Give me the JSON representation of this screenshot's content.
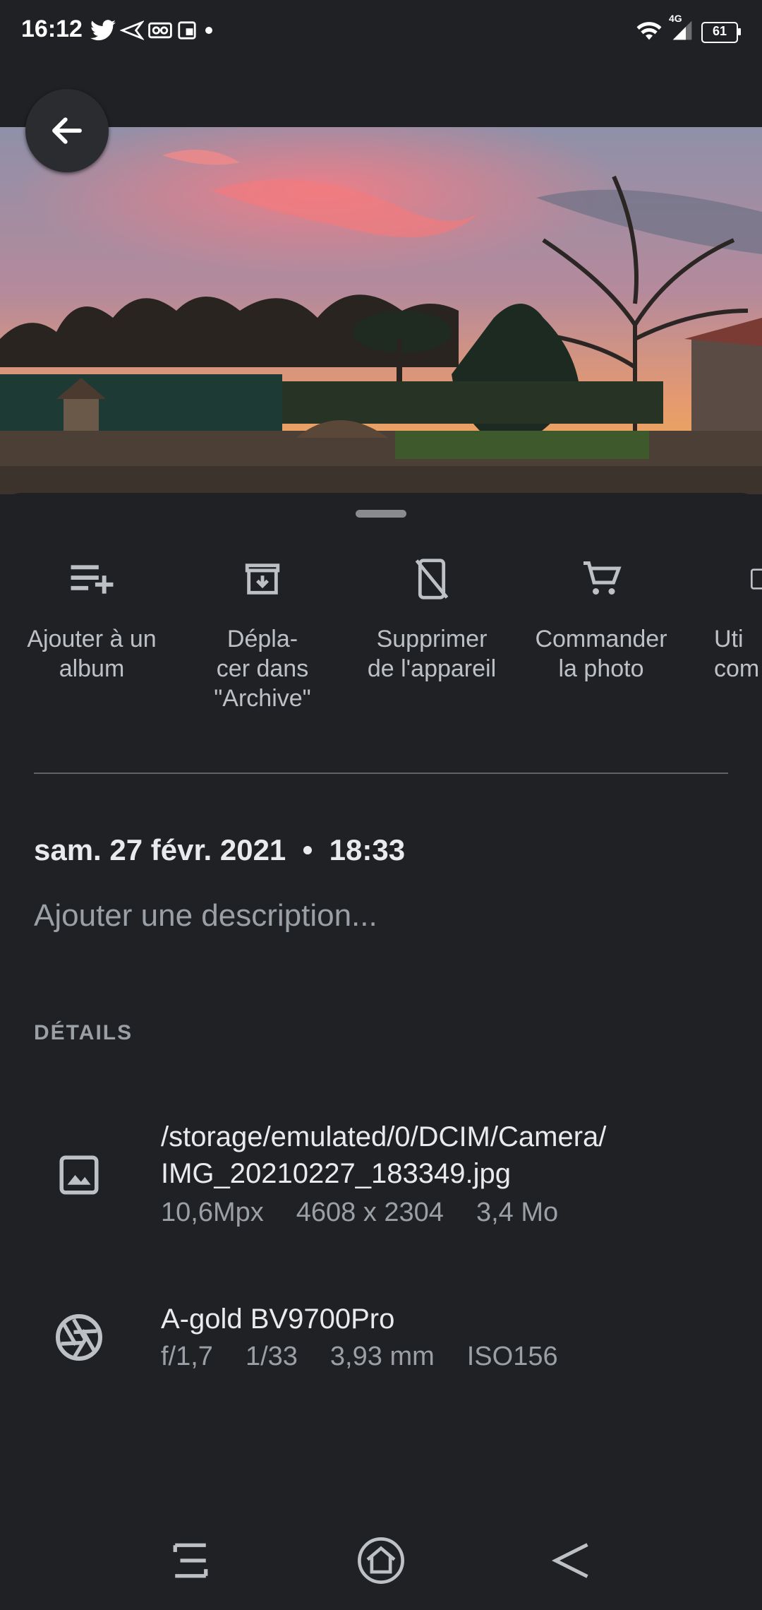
{
  "status_bar": {
    "time": "16:12",
    "network": "4G",
    "battery": "61",
    "notification_icons": [
      "twitter-icon",
      "send-icon",
      "voicemail-icon",
      "cast-icon",
      "dot-icon"
    ]
  },
  "actions": [
    {
      "label": "Ajouter à un\nalbum",
      "icon": "playlist-add-icon"
    },
    {
      "label": "Dépla-\ncer dans\n\"Archive\"",
      "icon": "archive-icon"
    },
    {
      "label": "Supprimer\nde l'appareil",
      "icon": "phone-delete-icon"
    },
    {
      "label": "Commander\nla photo",
      "icon": "cart-icon"
    },
    {
      "label": "Uti\ncom",
      "icon": "device-icon"
    }
  ],
  "datetime": "sam. 27 févr. 2021  •  18:33",
  "description_placeholder": "Ajouter une description...",
  "details_heading": "DÉTAILS",
  "file_info": {
    "path_line1": "/storage/emulated/0/DCIM/Camera/",
    "path_line2": "IMG_20210227_183349.jpg",
    "megapixels": "10,6Mpx",
    "resolution": "4608 x 2304",
    "size": "3,4 Mo"
  },
  "camera_info": {
    "model": "A-gold BV9700Pro",
    "aperture": "f/1,7",
    "exposure": "1/33",
    "focal_length": "3,93 mm",
    "iso": "ISO156"
  }
}
